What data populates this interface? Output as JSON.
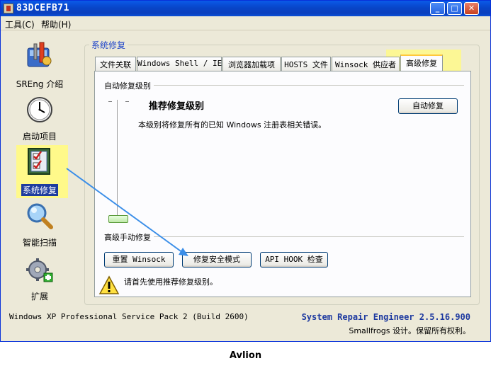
{
  "window": {
    "title": "83DCEFB71"
  },
  "titlebar_buttons": {
    "minimize": "_",
    "maximize": "□",
    "close": "✕"
  },
  "menu": [
    {
      "label": "工具(C)"
    },
    {
      "label": "帮助(H)"
    }
  ],
  "sidebar": {
    "items": [
      {
        "label": "SREng 介绍",
        "icon": "toolbox-icon"
      },
      {
        "label": "启动项目",
        "icon": "clock-icon"
      },
      {
        "label": "系统修复",
        "icon": "checklist-icon",
        "selected": true
      },
      {
        "label": "智能扫描",
        "icon": "magnifier-icon"
      },
      {
        "label": "扩展",
        "icon": "gear-plus-icon"
      }
    ]
  },
  "group": {
    "title": "系统修复"
  },
  "tabs": [
    {
      "label": "文件关联"
    },
    {
      "label": "Windows Shell / IE"
    },
    {
      "label": "浏览器加载项"
    },
    {
      "label": "HOSTS 文件"
    },
    {
      "label": "Winsock 供应者"
    },
    {
      "label": "高级修复",
      "active": true
    }
  ],
  "auto_repair": {
    "section_title": "自动修复级别",
    "level_title": "推荐修复级别",
    "description": "本级别将修复所有的已知 Windows 注册表相关错误。",
    "button": "自动修复"
  },
  "manual_repair": {
    "section_title": "高级手动修复",
    "buttons": [
      "重置 Winsock",
      "修复安全模式",
      "API HOOK 检查"
    ],
    "warning": "请首先使用推荐修复级别。"
  },
  "status": {
    "os": "Windows XP Professional Service Pack 2 (Build 2600)",
    "product": "System Repair Engineer 2.5.16.900",
    "copyright": "Smallfrogs 设计。保留所有权利。"
  },
  "caption": "Avlion",
  "colors": {
    "highlight": "#fff98a",
    "arrow": "#3a8ee8",
    "title_blue": "#0a46c8"
  }
}
